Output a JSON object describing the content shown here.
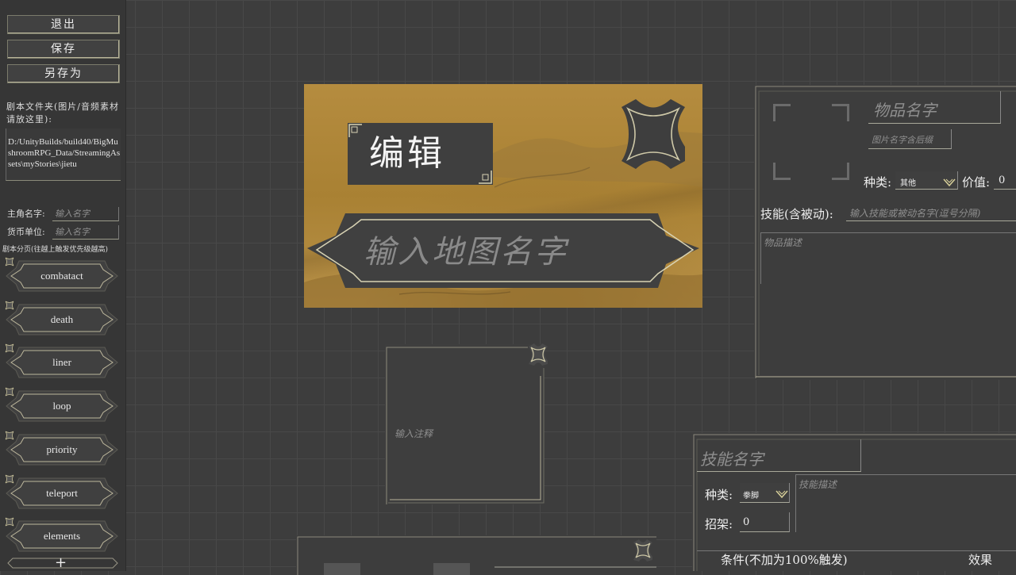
{
  "sidebar": {
    "buttons": {
      "exit": "退出",
      "save": "保存",
      "save_as": "另存为"
    },
    "folder_label": "剧本文件夹(图片/音频素材请放这里):",
    "folder_path": "D:/UnityBuilds/build40/BigMushroomRPG_Data/StreamingAssets\\myStories\\jietu",
    "hero_name_label": "主角名字:",
    "hero_name_placeholder": "输入名字",
    "currency_label": "货币单位:",
    "currency_placeholder": "输入名字",
    "pages_label": "剧本分页(往越上触发优先级越高)",
    "pages": [
      "combatact",
      "death",
      "liner",
      "loop",
      "priority",
      "teleport",
      "elements"
    ],
    "add_symbol": "+"
  },
  "map_card": {
    "edit_label": "编辑",
    "map_name_placeholder": "输入地图名字"
  },
  "note_card": {
    "placeholder": "输入注释"
  },
  "item_panel": {
    "name_placeholder": "物品名字",
    "image_name_placeholder": "图片名字含后缀",
    "type_label": "种类:",
    "type_value": "其他",
    "value_label": "价值:",
    "value_value": "0",
    "skill_label": "技能(含被动):",
    "skill_placeholder": "输入技能或被动名字(逗号分隔)",
    "desc_placeholder": "物品描述"
  },
  "skill_panel": {
    "name_placeholder": "技能名字",
    "type_label": "种类:",
    "type_value": "拳脚",
    "desc_placeholder": "技能描述",
    "parry_label": "招架:",
    "parry_value": "0",
    "condition_header": "条件(不加为100%触发)",
    "effect_header": "效果"
  },
  "colors": {
    "bg": "#3d3d3d",
    "panel": "#3f3f3f",
    "accent_gold": "#c9c29a",
    "map_paper": "#b08a3d"
  }
}
